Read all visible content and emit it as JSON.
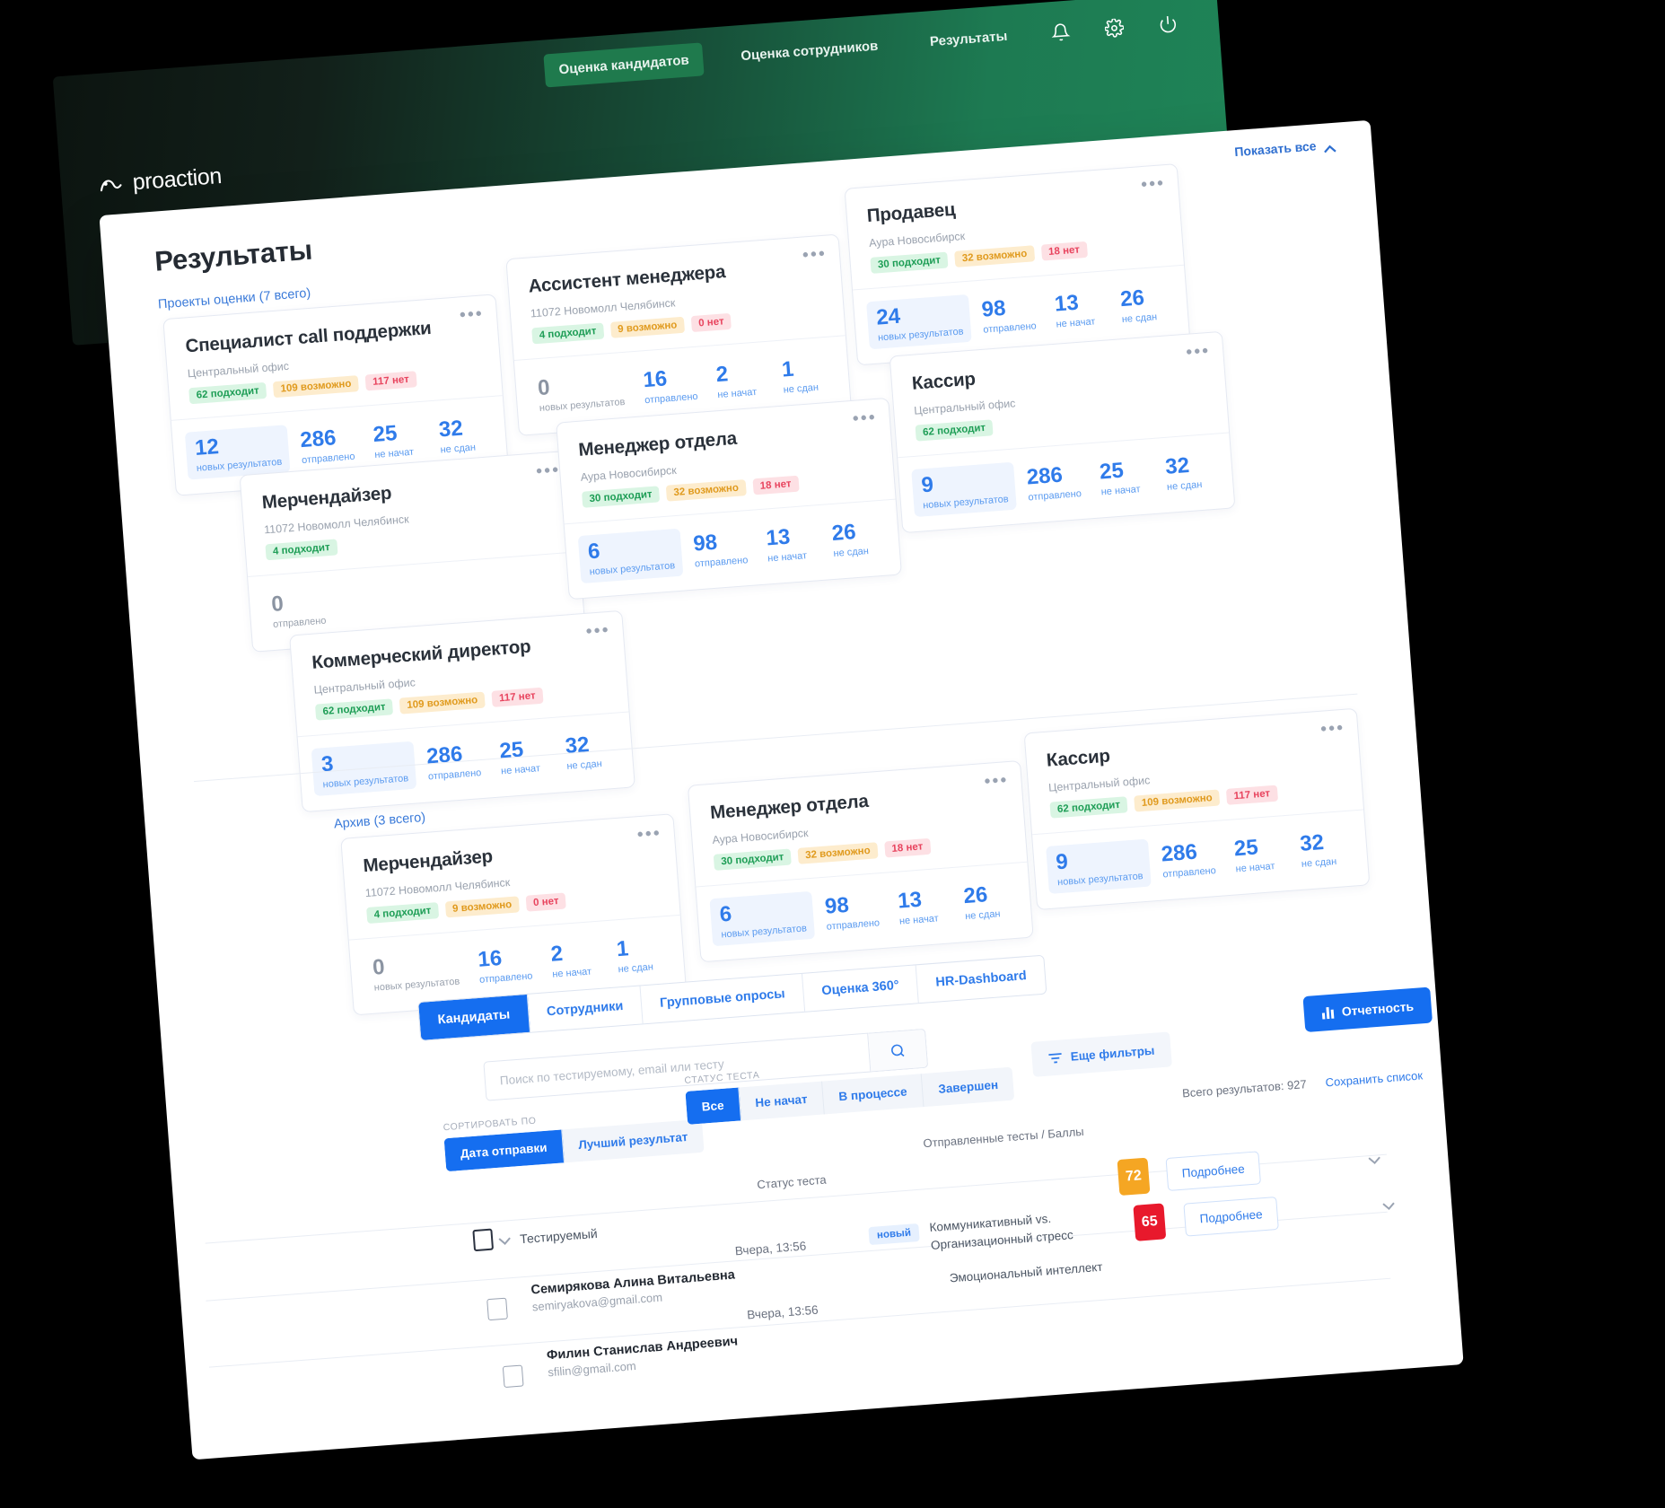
{
  "brand": {
    "name": "proaction"
  },
  "topnav": {
    "items": [
      {
        "label": "Оценка кандидатов",
        "active": true
      },
      {
        "label": "Оценка сотрудников",
        "active": false
      },
      {
        "label": "Результаты",
        "active": false
      }
    ],
    "icons": [
      "bell-icon",
      "gear-icon",
      "power-icon"
    ]
  },
  "page": {
    "title": "Результаты",
    "show_all": "Показать все",
    "groups": {
      "projects": "Проекты оценки (7 всего)",
      "archive": "Архив (3 всего)"
    }
  },
  "stat_labels": {
    "new": "новых результатов",
    "sent": "отправлено",
    "not_started": "не начат",
    "failed": "не сдан"
  },
  "cards": [
    {
      "title": "Специалист call поддержки",
      "office": "Центральный офис",
      "chips": [
        {
          "num": "62",
          "text": "подходит",
          "tone": "green"
        },
        {
          "num": "109",
          "text": "возможно",
          "tone": "amber"
        },
        {
          "num": "117",
          "text": "нет",
          "tone": "red"
        }
      ],
      "stats": [
        {
          "num": "12",
          "label": "новых результатов",
          "hl": true
        },
        {
          "num": "286",
          "label": "отправлено"
        },
        {
          "num": "25",
          "label": "не начат"
        },
        {
          "num": "32",
          "label": "не сдан"
        }
      ]
    },
    {
      "title": "Мерчендайзер",
      "office": "11072 Новомолл Челябинск",
      "chips": [
        {
          "num": "4",
          "text": "подходит",
          "tone": "green"
        }
      ],
      "stats": [
        {
          "num": "0",
          "label": "отправлено",
          "grey": true
        }
      ]
    },
    {
      "title": "Коммерческий директор",
      "office": "Центральный офис",
      "chips": [
        {
          "num": "62",
          "text": "подходит",
          "tone": "green"
        },
        {
          "num": "109",
          "text": "возможно",
          "tone": "amber"
        },
        {
          "num": "117",
          "text": "нет",
          "tone": "red"
        }
      ],
      "stats": [
        {
          "num": "3",
          "label": "новых результатов",
          "hl": true
        },
        {
          "num": "286",
          "label": "отправлено"
        },
        {
          "num": "25",
          "label": "не начат"
        },
        {
          "num": "32",
          "label": "не сдан"
        }
      ]
    },
    {
      "title": "Ассистент менеджера",
      "office": "11072 Новомолл Челябинск",
      "chips": [
        {
          "num": "4",
          "text": "подходит",
          "tone": "green"
        },
        {
          "num": "9",
          "text": "возможно",
          "tone": "amber"
        },
        {
          "num": "0",
          "text": "нет",
          "tone": "red"
        }
      ],
      "stats": [
        {
          "num": "0",
          "label": "новых результатов",
          "grey": true
        },
        {
          "num": "16",
          "label": "отправлено"
        },
        {
          "num": "2",
          "label": "не начат"
        },
        {
          "num": "1",
          "label": "не сдан"
        }
      ]
    },
    {
      "title": "Менеджер отдела",
      "office": "Аура Новосибирск",
      "chips": [
        {
          "num": "30",
          "text": "подходит",
          "tone": "green"
        },
        {
          "num": "32",
          "text": "возможно",
          "tone": "amber"
        },
        {
          "num": "18",
          "text": "нет",
          "tone": "red"
        }
      ],
      "stats": [
        {
          "num": "6",
          "label": "новых результатов",
          "hl": true
        },
        {
          "num": "98",
          "label": "отправлено"
        },
        {
          "num": "13",
          "label": "не начат"
        },
        {
          "num": "26",
          "label": "не сдан"
        }
      ]
    },
    {
      "title": "Продавец",
      "office": "Аура Новосибирск",
      "chips": [
        {
          "num": "30",
          "text": "подходит",
          "tone": "green"
        },
        {
          "num": "32",
          "text": "возможно",
          "tone": "amber"
        },
        {
          "num": "18",
          "text": "нет",
          "tone": "red"
        }
      ],
      "stats": [
        {
          "num": "24",
          "label": "новых результатов",
          "hl": true
        },
        {
          "num": "98",
          "label": "отправлено"
        },
        {
          "num": "13",
          "label": "не начат"
        },
        {
          "num": "26",
          "label": "не сдан"
        }
      ]
    },
    {
      "title": "Кассир",
      "office": "Центральный офис",
      "chips": [
        {
          "num": "62",
          "text": "подходит",
          "tone": "green"
        }
      ],
      "stats": [
        {
          "num": "9",
          "label": "новых результатов",
          "hl": true
        },
        {
          "num": "286",
          "label": "отправлено"
        },
        {
          "num": "25",
          "label": "не начат"
        },
        {
          "num": "32",
          "label": "не сдан"
        }
      ]
    }
  ],
  "archive_cards": [
    {
      "title": "Мерчендайзер",
      "office": "11072 Новомолл Челябинск",
      "chips": [
        {
          "num": "4",
          "text": "подходит",
          "tone": "green"
        },
        {
          "num": "9",
          "text": "возможно",
          "tone": "amber"
        },
        {
          "num": "0",
          "text": "нет",
          "tone": "red"
        }
      ],
      "stats": [
        {
          "num": "0",
          "label": "новых результатов",
          "grey": true
        },
        {
          "num": "16",
          "label": "отправлено"
        },
        {
          "num": "2",
          "label": "не начат"
        },
        {
          "num": "1",
          "label": "не сдан"
        }
      ]
    },
    {
      "title": "Менеджер отдела",
      "office": "Аура Новосибирск",
      "chips": [
        {
          "num": "30",
          "text": "подходит",
          "tone": "green"
        },
        {
          "num": "32",
          "text": "возможно",
          "tone": "amber"
        },
        {
          "num": "18",
          "text": "нет",
          "tone": "red"
        }
      ],
      "stats": [
        {
          "num": "6",
          "label": "новых результатов",
          "hl": true
        },
        {
          "num": "98",
          "label": "отправлено"
        },
        {
          "num": "13",
          "label": "не начат"
        },
        {
          "num": "26",
          "label": "не сдан"
        }
      ]
    },
    {
      "title": "Кассир",
      "office": "Центральный офис",
      "chips": [
        {
          "num": "62",
          "text": "подходит",
          "tone": "green"
        },
        {
          "num": "109",
          "text": "возможно",
          "tone": "amber"
        },
        {
          "num": "117",
          "text": "нет",
          "tone": "red"
        }
      ],
      "stats": [
        {
          "num": "9",
          "label": "новых результатов",
          "hl": true
        },
        {
          "num": "286",
          "label": "отправлено"
        },
        {
          "num": "25",
          "label": "не начат"
        },
        {
          "num": "32",
          "label": "не сдан"
        }
      ]
    }
  ],
  "tabs": [
    {
      "label": "Кандидаты",
      "active": true
    },
    {
      "label": "Сотрудники",
      "active": false
    },
    {
      "label": "Групповые опросы",
      "active": false
    },
    {
      "label": "Оценка 360°",
      "active": false
    },
    {
      "label": "HR-Dashboard",
      "active": false
    }
  ],
  "search": {
    "placeholder": "Поиск по тестируемому, email или тесту",
    "value": "",
    "icon": "search-icon"
  },
  "filters": {
    "more_filters": "Еще фильтры",
    "reporting": "Отчетность",
    "sort_label": "СОРТИРОВАТЬ ПО",
    "sort_options": [
      {
        "label": "Дата отправки",
        "active": true
      },
      {
        "label": "Лучший результат",
        "active": false
      }
    ],
    "status_label": "СТАТУС ТЕСТА",
    "status_options": [
      {
        "label": "Все",
        "active": true
      },
      {
        "label": "Не начат",
        "active": false
      },
      {
        "label": "В процессе",
        "active": false
      },
      {
        "label": "Завершен",
        "active": false
      }
    ]
  },
  "table": {
    "total": "Всего результатов: 927",
    "save_list": "Сохранить список",
    "headers": {
      "person": "Тестируемый",
      "status": "Статус теста",
      "tests": "Отправленные тесты / Баллы"
    },
    "rows": [
      {
        "name": "Семирякова Алина Витальевна",
        "email": "semiryakova@gmail.com",
        "date": "Вчера, 13:56",
        "badge": "новый",
        "test": "Коммуникативный vs. Организационный стресс",
        "score": "72",
        "score_tone": "amber",
        "action": "Подробнее"
      },
      {
        "name": "Филин Станислав Андреевич",
        "email": "sfilin@gmail.com",
        "date": "Вчера, 13:56",
        "badge": "",
        "test": "Эмоциональный интеллект",
        "score": "65",
        "score_tone": "red",
        "action": "Подробнее"
      }
    ]
  },
  "colors": {
    "brand_green": "#1f8457",
    "accent_blue": "#156ef0",
    "link_blue": "#2f7bea",
    "green": "#1d9d55",
    "amber": "#e09a1d",
    "red": "#e8455f"
  }
}
